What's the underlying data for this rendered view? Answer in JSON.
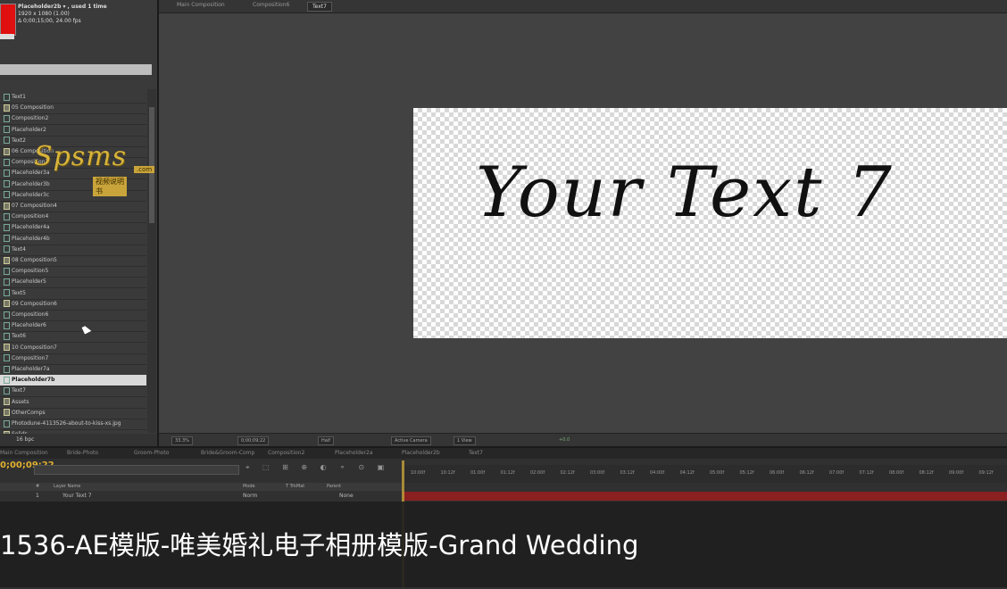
{
  "project": {
    "thumb_title": "Placeholder2b ▾ , used 1 time",
    "thumb_line2": "1920 x 1080 (1.00)",
    "thumb_line3": "Δ 0;00;15;00, 24.00 fps",
    "items": [
      {
        "label": "Text1",
        "kind": "text"
      },
      {
        "label": "05 Composition",
        "kind": "folder"
      },
      {
        "label": "Composition2",
        "kind": "comp"
      },
      {
        "label": "Placeholder2",
        "kind": "comp"
      },
      {
        "label": "Text2",
        "kind": "text"
      },
      {
        "label": "06 Composition",
        "kind": "folder"
      },
      {
        "label": "Composition3",
        "kind": "comp"
      },
      {
        "label": "Placeholder3a",
        "kind": "comp"
      },
      {
        "label": "Placeholder3b",
        "kind": "comp"
      },
      {
        "label": "Placeholder3c",
        "kind": "comp"
      },
      {
        "label": "07 Composition4",
        "kind": "folder"
      },
      {
        "label": "Composition4",
        "kind": "comp"
      },
      {
        "label": "Placeholder4a",
        "kind": "comp"
      },
      {
        "label": "Placeholder4b",
        "kind": "comp"
      },
      {
        "label": "Text4",
        "kind": "text"
      },
      {
        "label": "08 Composition5",
        "kind": "folder"
      },
      {
        "label": "Composition5",
        "kind": "comp"
      },
      {
        "label": "Placeholder5",
        "kind": "comp"
      },
      {
        "label": "Text5",
        "kind": "text"
      },
      {
        "label": "09 Composition6",
        "kind": "folder"
      },
      {
        "label": "Composition6",
        "kind": "comp"
      },
      {
        "label": "Placeholder6",
        "kind": "comp"
      },
      {
        "label": "Text6",
        "kind": "text"
      },
      {
        "label": "10 Composition7",
        "kind": "folder"
      },
      {
        "label": "Composition7",
        "kind": "comp"
      },
      {
        "label": "Placeholder7a",
        "kind": "comp"
      },
      {
        "label": "Placeholder7b",
        "kind": "comp",
        "selected": true
      },
      {
        "label": "Text7",
        "kind": "text"
      },
      {
        "label": "Assets",
        "kind": "folder"
      },
      {
        "label": "OtherComps",
        "kind": "folder"
      },
      {
        "label": "Photodune-4113526-about-to-kiss-xs.jpg",
        "kind": "file"
      },
      {
        "label": "Solids",
        "kind": "folder"
      }
    ],
    "footer_bpc": "16 bpc"
  },
  "watermark": {
    "main": "Spsms",
    "com": ".com",
    "sub": "视频说明书"
  },
  "viewer": {
    "tabs": [
      "Main Composition",
      "Composition6",
      "Text7"
    ],
    "comp_text": "Your Text 7",
    "toolbar": {
      "zoom": "33.3%",
      "timecode": "0;00;09;22",
      "resolution": "Half",
      "camera": "Active Camera",
      "views": "1 View",
      "exposure": "+0.0"
    }
  },
  "timeline": {
    "tabs": [
      "Main Composition",
      "Bride-Photo",
      "Groom-Photo",
      "Bride&Groom-Comp",
      "Composition2",
      "Placeholder2a",
      "Placeholder2b",
      "Text7"
    ],
    "timecode": "0;00;09;22",
    "ruler_ticks": [
      "10:00f",
      "10:12f",
      "01:00f",
      "01:12f",
      "02:00f",
      "02:12f",
      "03:00f",
      "03:12f",
      "04:00f",
      "04:12f",
      "05:00f",
      "05:12f",
      "06:00f",
      "06:12f",
      "07:00f",
      "07:12f",
      "08:00f",
      "08:12f",
      "09:00f",
      "09:12f"
    ],
    "columns": [
      "#",
      "Layer Name",
      "Mode",
      "T TrkMat",
      "Parent"
    ],
    "layer": {
      "index": "1",
      "name": "Your Text 7",
      "mode": "Norm",
      "parent": "None"
    }
  },
  "caption": "1536-AE模版-唯美婚礼电子相册模版-Grand Wedding"
}
